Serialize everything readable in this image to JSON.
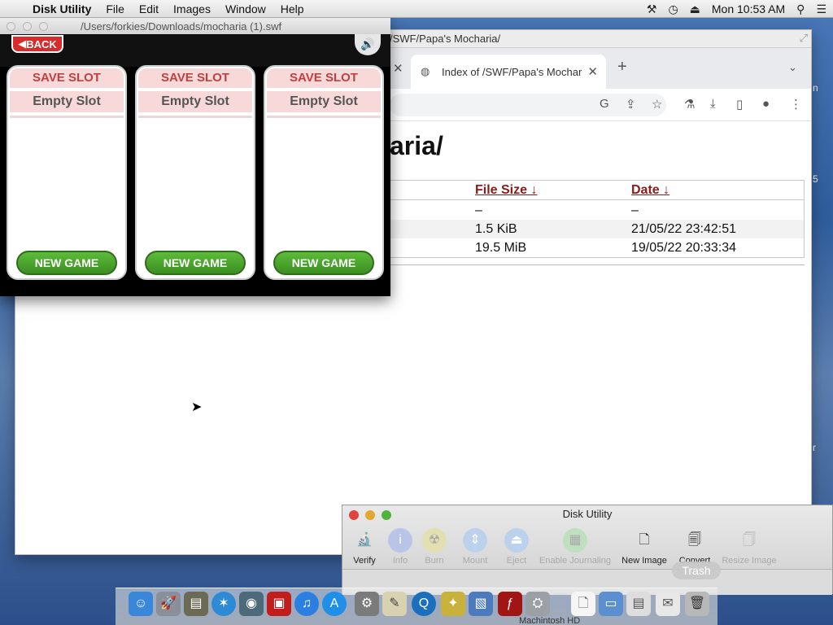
{
  "menubar": {
    "app_name": "Disk Utility",
    "items": [
      "File",
      "Edit",
      "Images",
      "Window",
      "Help"
    ],
    "clock": "Mon 10:53 AM"
  },
  "browser": {
    "title_path": "/SWF/Papa's Mocharia/",
    "tab_title": "Index of /SWF/Papa's Mochar",
    "heading": "aria/",
    "columns": [
      "File Size",
      "Date"
    ],
    "sort_glyph": "↓",
    "rows": [
      {
        "size": "–",
        "date": "–"
      },
      {
        "size": "1.5 KiB",
        "date": "21/05/22 23:42:51"
      },
      {
        "size": "19.5 MiB",
        "date": "19/05/22 20:33:34"
      }
    ],
    "edge_chars": [
      "n",
      "5",
      "r"
    ]
  },
  "flash": {
    "window_title": "/Users/forkies/Downloads/mocharia (1).swf",
    "back_label": "BACK",
    "slots": [
      {
        "header": "SAVE SLOT",
        "status": "Empty Slot",
        "button": "NEW GAME"
      },
      {
        "header": "SAVE SLOT",
        "status": "Empty Slot",
        "button": "NEW GAME"
      },
      {
        "header": "SAVE SLOT",
        "status": "Empty Slot",
        "button": "NEW GAME"
      }
    ]
  },
  "diskutility": {
    "title": "Disk Utility",
    "tools": [
      {
        "label": "Verify",
        "icon": "microscope-icon",
        "enabled": true
      },
      {
        "label": "Info",
        "icon": "info-icon",
        "enabled": false
      },
      {
        "label": "Burn",
        "icon": "burn-icon",
        "enabled": false
      },
      {
        "label": "Mount",
        "icon": "mount-icon",
        "enabled": false
      },
      {
        "label": "Eject",
        "icon": "eject-icon",
        "enabled": false
      },
      {
        "label": "Enable Journaling",
        "icon": "journal-icon",
        "enabled": false
      },
      {
        "label": "New Image",
        "icon": "new-image-icon",
        "enabled": true
      },
      {
        "label": "Convert",
        "icon": "convert-icon",
        "enabled": true
      },
      {
        "label": "Resize Image",
        "icon": "resize-image-icon",
        "enabled": false
      }
    ]
  },
  "dock": {
    "hover_label": "Trash",
    "faded_label": "Machintosh HD",
    "icons": [
      "finder-icon",
      "launchpad-icon",
      "photo-icon",
      "safari-icon",
      "facetime-icon",
      "photobooth-icon",
      "itunes-icon",
      "appstore-icon",
      "system-preferences-icon",
      "script-editor-icon",
      "quicktime-icon",
      "automator-icon",
      "virtualbox-icon",
      "flash-icon",
      "disk-utility-icon",
      "document-icon",
      "screenshot-icon",
      "preview-icon",
      "mail-icon",
      "trash-icon"
    ]
  }
}
